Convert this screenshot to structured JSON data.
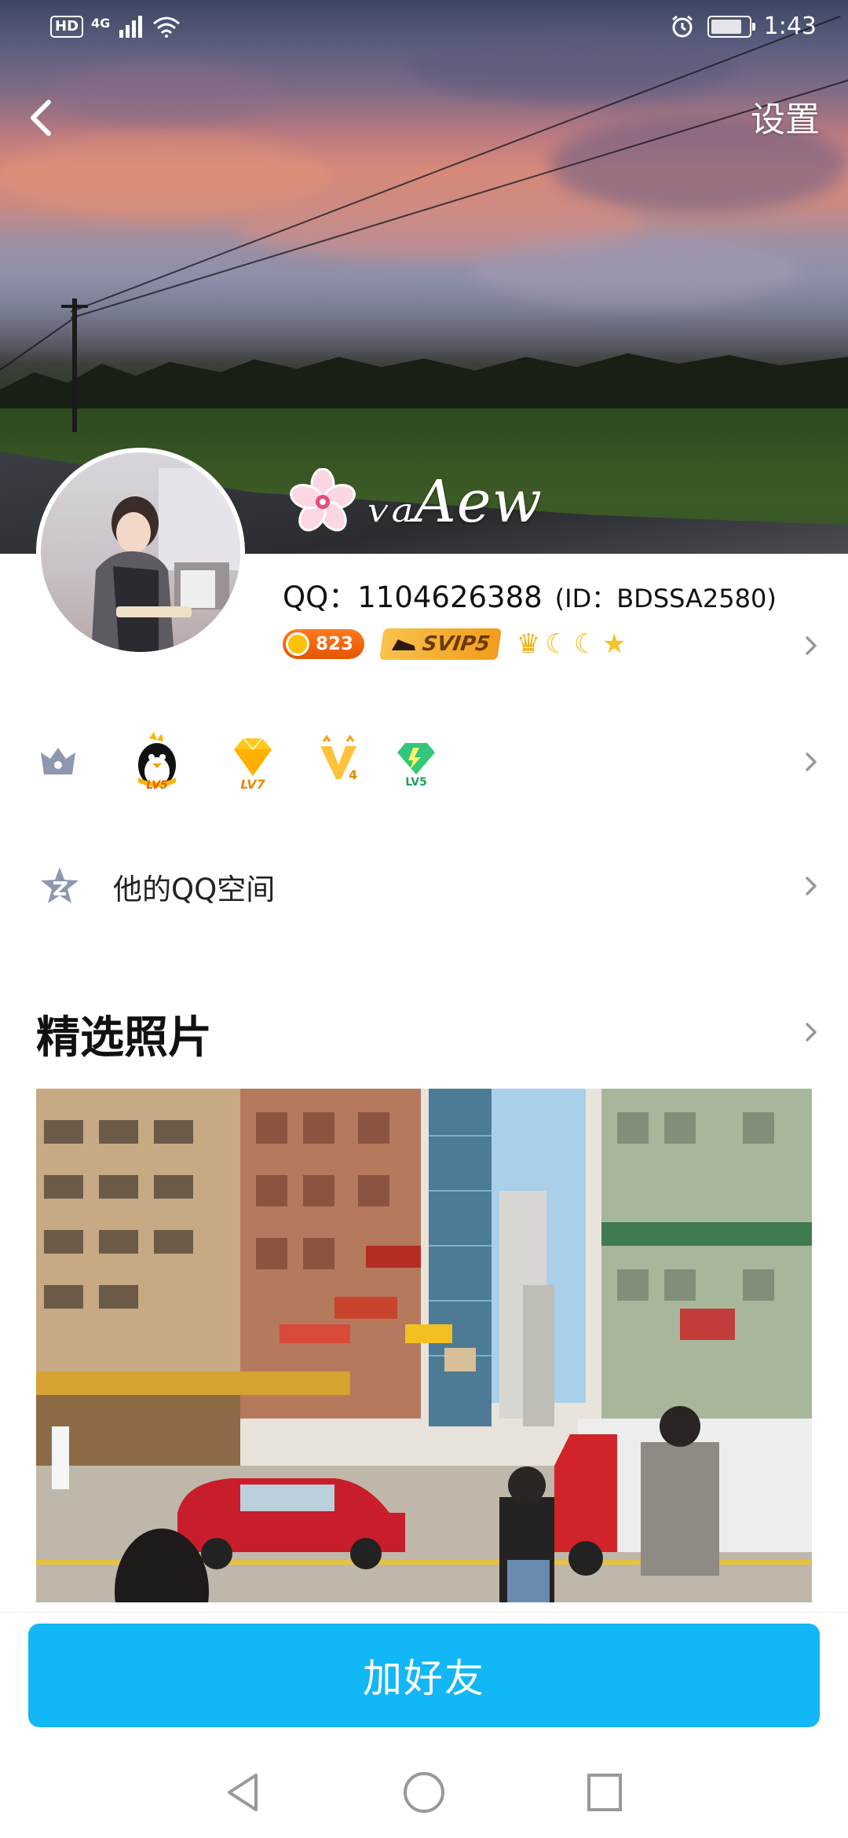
{
  "status_bar": {
    "hd": "HD",
    "network": "4G",
    "time": "1:43"
  },
  "header": {
    "settings_label": "设置",
    "nickname": "ᵥₐAew"
  },
  "profile": {
    "qq_label": "QQ：",
    "qq_number": "1104626388",
    "id_text": "(ID：BDSSA2580)",
    "coin_count": "823",
    "svip_label": "SVIP5",
    "level_icons": [
      "crown",
      "moon",
      "moon",
      "star"
    ]
  },
  "vip_row": {
    "icons": [
      {
        "name": "penguin-level",
        "label": "LV5"
      },
      {
        "name": "yellow-diamond",
        "label": "LV7"
      },
      {
        "name": "v-badge",
        "label": "4"
      },
      {
        "name": "green-gem",
        "label": "LV5"
      }
    ]
  },
  "qzone_row": {
    "label": "他的QQ空间"
  },
  "photos_section": {
    "title": "精选照片"
  },
  "bottom": {
    "add_friend_label": "加好友"
  },
  "colors": {
    "primary_button": "#12b7f5",
    "coin_orange": "#ff7b1c",
    "svip_gold": "#f8c24a"
  }
}
